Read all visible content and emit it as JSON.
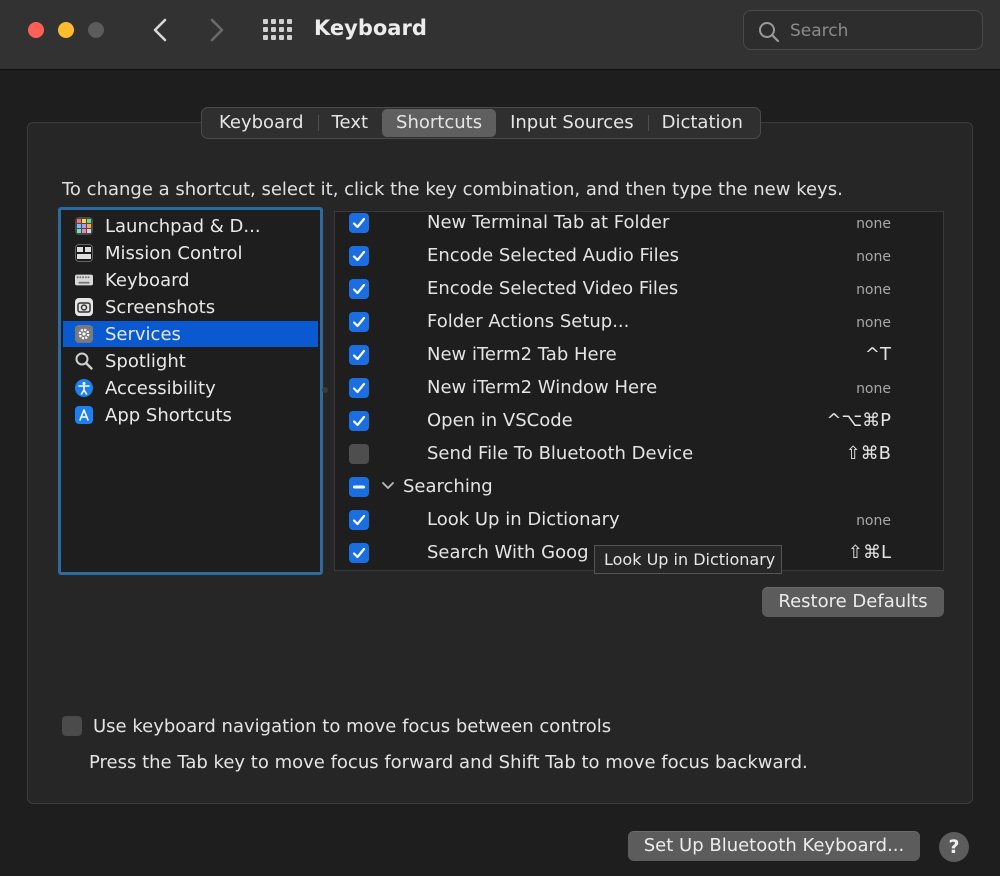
{
  "window": {
    "title": "Keyboard",
    "search_placeholder": "Search"
  },
  "tabs": [
    {
      "label": "Keyboard",
      "active": false
    },
    {
      "label": "Text",
      "active": false
    },
    {
      "label": "Shortcuts",
      "active": true
    },
    {
      "label": "Input Sources",
      "active": false
    },
    {
      "label": "Dictation",
      "active": false
    }
  ],
  "instructions": "To change a shortcut, select it, click the key combination, and then type the new keys.",
  "categories": [
    {
      "label": "Launchpad & D...",
      "icon": "launchpad-icon",
      "selected": false
    },
    {
      "label": "Mission Control",
      "icon": "mission-control-icon",
      "selected": false
    },
    {
      "label": "Keyboard",
      "icon": "keyboard-icon",
      "selected": false
    },
    {
      "label": "Screenshots",
      "icon": "screenshot-icon",
      "selected": false
    },
    {
      "label": "Services",
      "icon": "gear-icon",
      "selected": true
    },
    {
      "label": "Spotlight",
      "icon": "magnifier-icon",
      "selected": false
    },
    {
      "label": "Accessibility",
      "icon": "accessibility-icon",
      "selected": false
    },
    {
      "label": "App Shortcuts",
      "icon": "app-store-icon",
      "selected": false
    }
  ],
  "services": [
    {
      "label": "New Terminal Tab at Folder",
      "checked": true,
      "shortcut": "none"
    },
    {
      "label": "Encode Selected Audio Files",
      "checked": true,
      "shortcut": "none"
    },
    {
      "label": "Encode Selected Video Files",
      "checked": true,
      "shortcut": "none"
    },
    {
      "label": "Folder Actions Setup...",
      "checked": true,
      "shortcut": "none"
    },
    {
      "label": "New iTerm2 Tab Here",
      "checked": true,
      "shortcut": "^T"
    },
    {
      "label": "New iTerm2 Window Here",
      "checked": true,
      "shortcut": "none"
    },
    {
      "label": "Open in VSCode",
      "checked": true,
      "shortcut": "^⌥⌘P"
    },
    {
      "label": "Send File To Bluetooth Device",
      "checked": false,
      "shortcut": "⇧⌘B"
    },
    {
      "label": "Searching",
      "group": true,
      "state": "mixed"
    },
    {
      "label": "Look Up in Dictionary",
      "checked": true,
      "shortcut": "none"
    },
    {
      "label": "Search With Goog",
      "checked": true,
      "shortcut": "⇧⌘L"
    }
  ],
  "tooltip": "Look Up in Dictionary",
  "buttons": {
    "restore_defaults": "Restore Defaults",
    "setup_bluetooth": "Set Up Bluetooth Keyboard...",
    "help": "?"
  },
  "keyboard_navigation": {
    "label": "Use keyboard navigation to move focus between controls",
    "checked": false,
    "help_text": "Press the Tab key to move focus forward and Shift Tab to move focus backward."
  },
  "colors": {
    "accent": "#0a59d0",
    "checkbox_on": "#1a6ee0",
    "close": "#fe5f57",
    "minimize": "#febc2e"
  }
}
